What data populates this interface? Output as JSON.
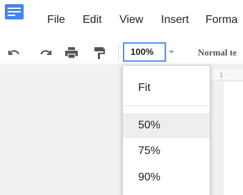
{
  "app": {
    "icon": "docs-icon"
  },
  "menu": {
    "items": [
      {
        "label": "File"
      },
      {
        "label": "Edit"
      },
      {
        "label": "View"
      },
      {
        "label": "Insert"
      },
      {
        "label": "Forma"
      }
    ]
  },
  "toolbar": {
    "undo_icon": "undo-icon",
    "redo_icon": "redo-icon",
    "print_icon": "print-icon",
    "paint_format_icon": "paint-format-icon",
    "zoom_value": "100%",
    "style_value": "Normal te"
  },
  "ruler": {
    "mark": "1 ·"
  },
  "zoom_menu": {
    "items": [
      {
        "label": "Fit",
        "highlighted": false
      },
      {
        "label": "50%",
        "highlighted": true
      },
      {
        "label": "75%",
        "highlighted": false
      },
      {
        "label": "90%",
        "highlighted": false
      }
    ]
  },
  "colors": {
    "accent": "#4d90fe",
    "doc_icon": "#4285f4",
    "highlight": "#eeeeee"
  }
}
